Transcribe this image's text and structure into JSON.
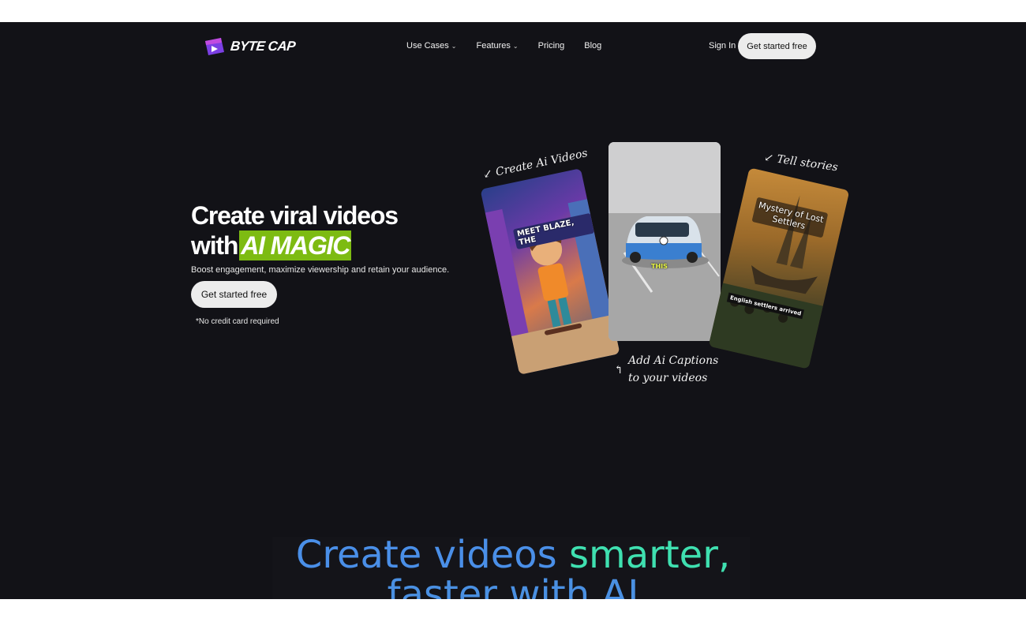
{
  "brand": {
    "name": "BYTE CAP",
    "icon": "play-logo-icon",
    "colors": [
      "#7b3fe4",
      "#c14be0",
      "#4a7cf0"
    ]
  },
  "nav": {
    "items": [
      {
        "label": "Use Cases",
        "has_dropdown": true
      },
      {
        "label": "Features",
        "has_dropdown": true
      },
      {
        "label": "Pricing",
        "has_dropdown": false
      },
      {
        "label": "Blog",
        "has_dropdown": false
      }
    ],
    "chevron": "⌄",
    "sign_in": "Sign In",
    "cta": "Get started free"
  },
  "hero": {
    "title_line1": "Create viral videos",
    "title_line2_prefix": "with",
    "title_highlight": "AI MAGIC",
    "subtitle": "Boost engagement, maximize viewership and retain your audience.",
    "cta": "Get started free",
    "note": "*No credit card required",
    "highlight_color": "#7dbb12"
  },
  "cards": {
    "left": {
      "label": "↙ Create Ai Videos",
      "caption": "MEET BLAZE, THE"
    },
    "middle": {
      "label_line1": "Add Ai Captions",
      "label_line2": "to your videos",
      "arrow": "↰",
      "caption": "THIS"
    },
    "right": {
      "label": "↙ Tell stories",
      "title_line1": "Mystery of Lost",
      "title_line2": "Settlers",
      "caption": "English settlers arrived"
    }
  },
  "section2": {
    "title_part1": "Create videos",
    "title_part2": "smarter,",
    "title_line2": "faster with AI",
    "gradient": [
      "#4a8fe8",
      "#3fe0b0"
    ]
  },
  "colors": {
    "background": "#121217",
    "button_bg": "#ececec"
  }
}
